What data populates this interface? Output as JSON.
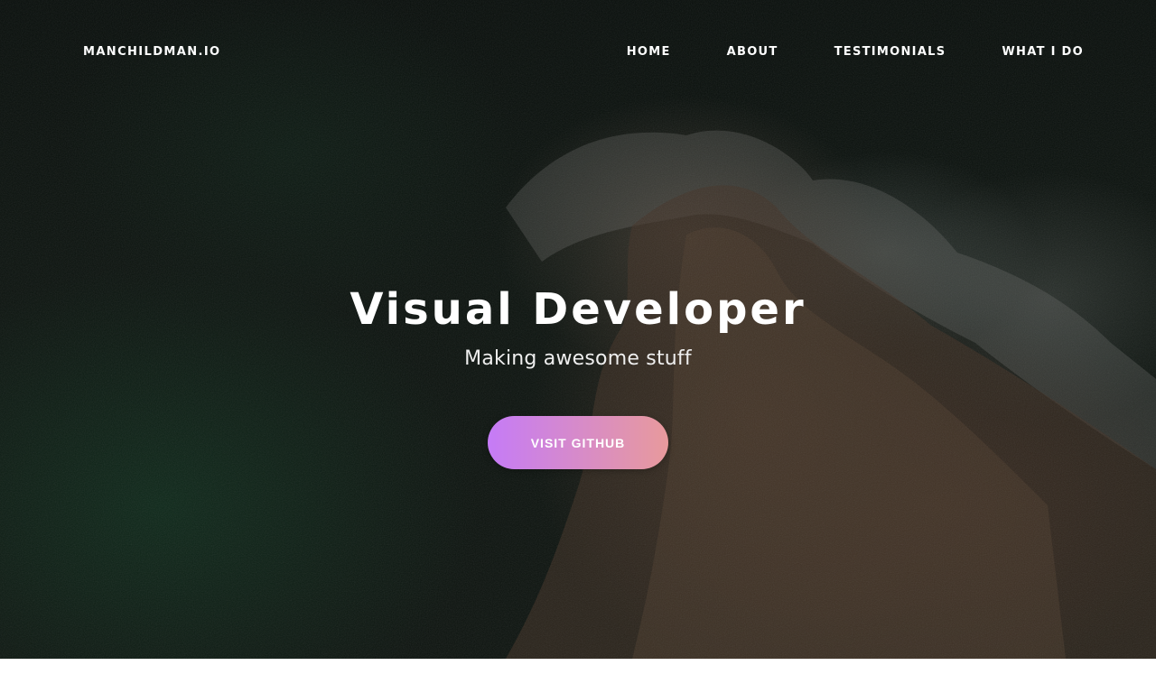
{
  "nav": {
    "brand": "MANCHILDMAN.IO",
    "links": [
      {
        "label": "HOME"
      },
      {
        "label": "ABOUT"
      },
      {
        "label": "TESTIMONIALS"
      },
      {
        "label": "WHAT I DO"
      }
    ]
  },
  "hero": {
    "title": "Visual Developer",
    "subtitle": "Making awesome stuff",
    "cta_label": "VISIT GITHUB",
    "background_description": "aerial ocean and rocky coastline",
    "colors": {
      "cta_gradient_start": "#c57bf7",
      "cta_gradient_end": "#e89a9c"
    }
  }
}
